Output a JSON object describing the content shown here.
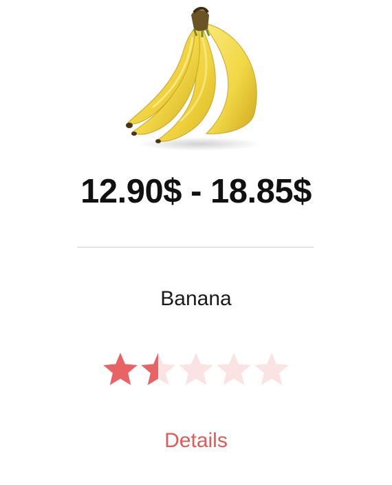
{
  "product": {
    "name": "Banana",
    "price_range": "12.90$ - 18.85$",
    "image_icon": "banana-image",
    "rating": {
      "value": 1.5,
      "max": 5,
      "filled_color": "#e86363",
      "empty_color": "#fbe3e3"
    },
    "details_label": "Details"
  },
  "colors": {
    "accent": "#e05a58",
    "text": "#111111",
    "divider": "#e4e4e4"
  }
}
